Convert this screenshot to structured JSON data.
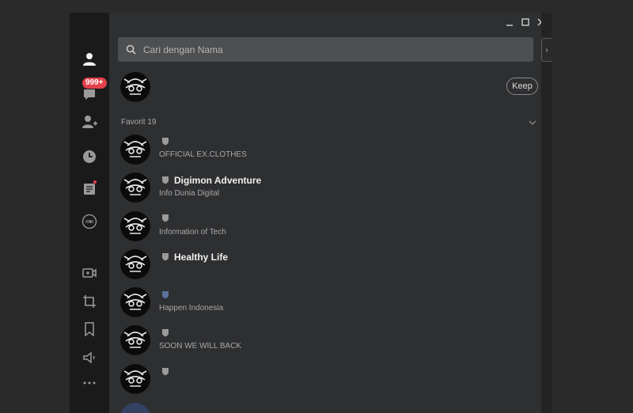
{
  "sidebar": {
    "chat_badge": "999+"
  },
  "search": {
    "placeholder": "Cari dengan Nama"
  },
  "profile": {
    "keep_label": "Keep"
  },
  "favorites": {
    "label": "Favorit 19"
  },
  "right_tab": {
    "arrow": "›"
  },
  "contacts": [
    {
      "name": "",
      "status": "OFFICIAL EX.CLOTHES",
      "shield": "gray"
    },
    {
      "name": "Digimon Adventure",
      "status": "Info Dunia Digital",
      "shield": "gray"
    },
    {
      "name": "",
      "status": "Information of Tech",
      "shield": "gray"
    },
    {
      "name": "Healthy Life",
      "status": "",
      "shield": "gray"
    },
    {
      "name": "",
      "status": "Happen Indonesia",
      "shield": "blue"
    },
    {
      "name": "",
      "status": "SOON WE WILL BACK",
      "shield": "gray"
    },
    {
      "name": "",
      "status": "",
      "shield": "gray"
    }
  ]
}
